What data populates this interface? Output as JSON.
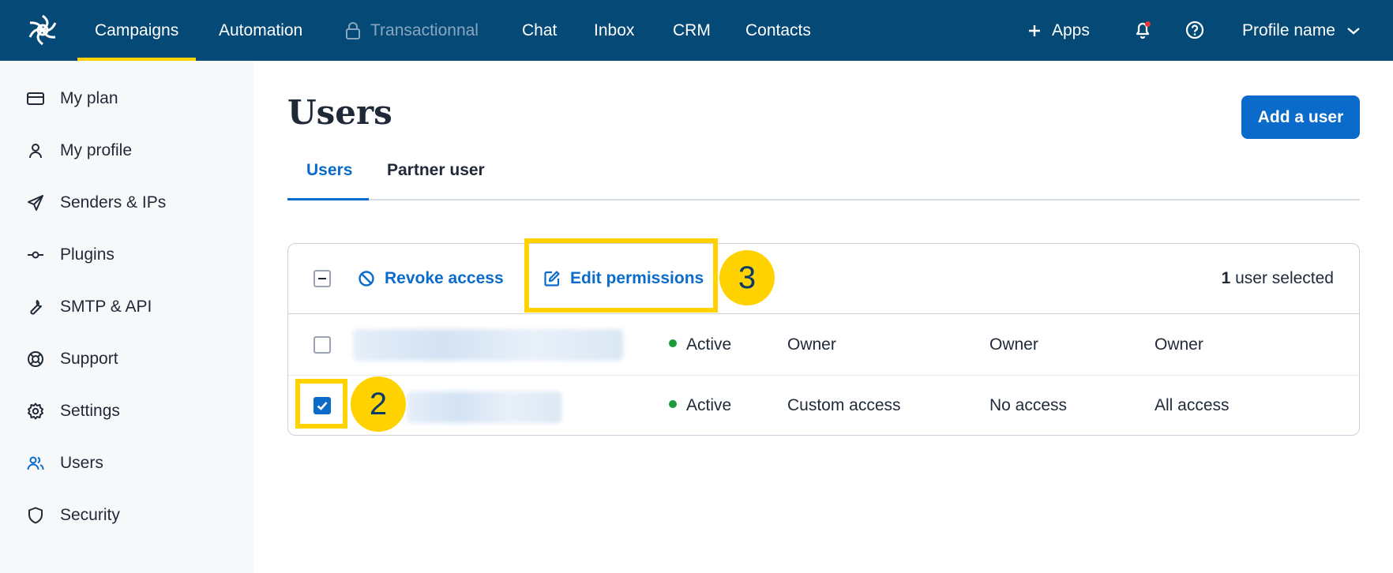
{
  "nav": {
    "items": [
      {
        "label": "Campaigns"
      },
      {
        "label": "Automation"
      },
      {
        "label": "Transactionnal"
      },
      {
        "label": "Chat"
      },
      {
        "label": "Inbox"
      },
      {
        "label": "CRM"
      },
      {
        "label": "Contacts"
      }
    ],
    "apps_label": "Apps",
    "profile_label": "Profile name"
  },
  "sidebar": {
    "items": [
      {
        "label": "My plan"
      },
      {
        "label": "My profile"
      },
      {
        "label": "Senders & IPs"
      },
      {
        "label": "Plugins"
      },
      {
        "label": "SMTP & API"
      },
      {
        "label": "Support"
      },
      {
        "label": "Settings"
      },
      {
        "label": "Users"
      },
      {
        "label": "Security"
      }
    ]
  },
  "main": {
    "title": "Users",
    "add_button": "Add a user",
    "tabs": [
      {
        "label": "Users"
      },
      {
        "label": "Partner user"
      }
    ],
    "toolbar": {
      "revoke_label": "Revoke access",
      "edit_label": "Edit permissions",
      "selected_count": "1",
      "selected_suffix": " user selected"
    },
    "rows": [
      {
        "status": "Active",
        "col1": "Owner",
        "col2": "Owner",
        "col3": "Owner",
        "checked": false
      },
      {
        "status": "Active",
        "col1": "Custom access",
        "col2": "No access",
        "col3": "All access",
        "checked": true
      }
    ]
  },
  "annotations": {
    "step2": "2",
    "step3": "3"
  },
  "colors": {
    "nav_bg": "#054a77",
    "accent": "#0b6bcb",
    "highlight": "#ffd200",
    "status_active": "#1a9c3a"
  }
}
